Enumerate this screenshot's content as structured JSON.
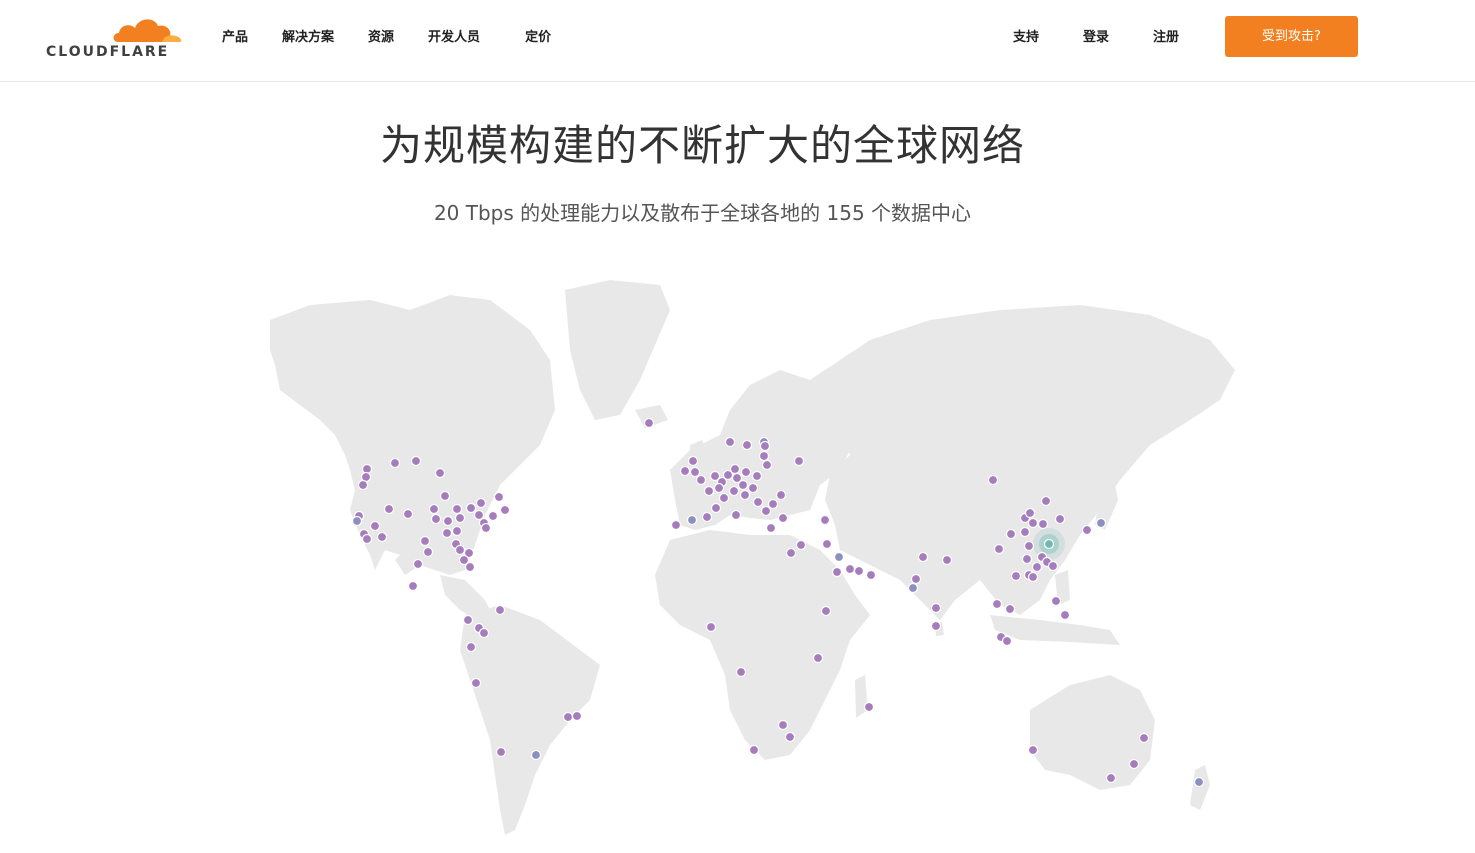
{
  "header": {
    "logo_text": "CLOUDFLARE",
    "nav_left": [
      "产品",
      "解决方案",
      "资源",
      "开发人员",
      "定价"
    ],
    "nav_right": [
      "支持",
      "登录",
      "注册"
    ],
    "cta_label": "受到攻击?",
    "cta_color": "#f38020"
  },
  "hero": {
    "title": "为规模构建的不断扩大的全球网络",
    "subtitle": "20 Tbps 的处理能力以及散布于全球各地的 155 个数据中心"
  },
  "map": {
    "land_color": "#e8e8e8",
    "marker_color": "#a57dbd",
    "highlight_color": "#6fb8b3"
  }
}
